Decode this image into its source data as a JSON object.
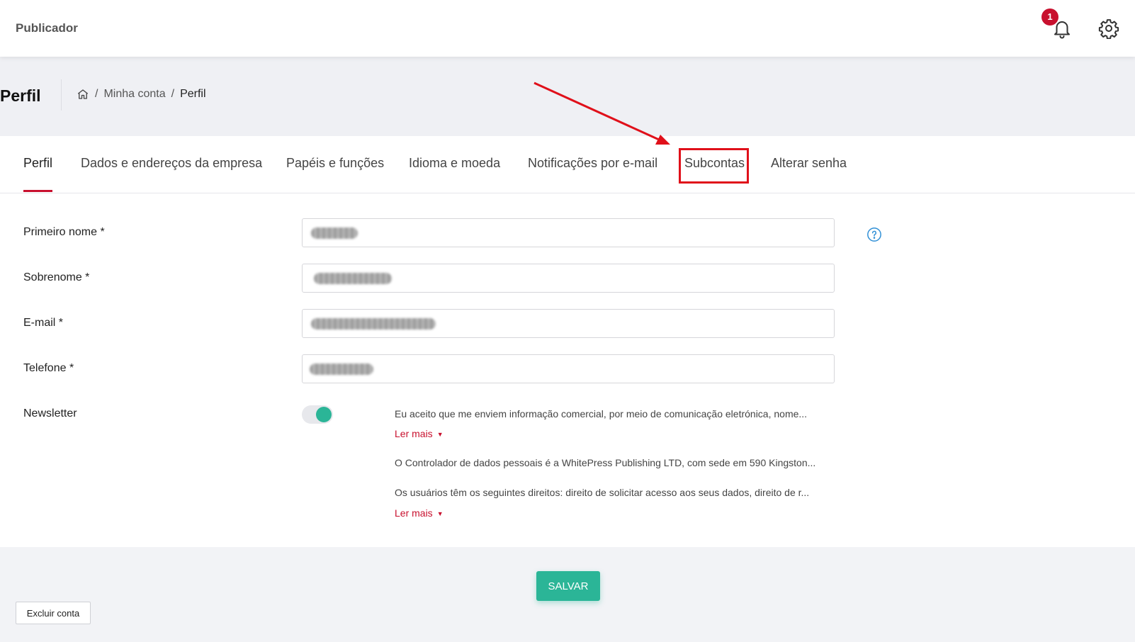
{
  "topbar": {
    "app_title": "Publicador",
    "notification_count": "1"
  },
  "header": {
    "page_title": "Perfil",
    "breadcrumb": {
      "separator": "/",
      "items": [
        "Minha conta",
        "Perfil"
      ]
    }
  },
  "tabs": [
    {
      "label": "Perfil",
      "active": true
    },
    {
      "label": "Dados e endereços da empresa",
      "active": false
    },
    {
      "label": "Papéis e funções",
      "active": false
    },
    {
      "label": "Idioma e moeda",
      "active": false
    },
    {
      "label": "Notificações por e-mail",
      "active": false
    },
    {
      "label": "Subcontas",
      "active": false
    },
    {
      "label": "Alterar senha",
      "active": false
    }
  ],
  "form": {
    "first_name_label": "Primeiro nome *",
    "last_name_label": "Sobrenome *",
    "email_label": "E-mail *",
    "phone_label": "Telefone *",
    "newsletter_label": "Newsletter",
    "newsletter_enabled": true
  },
  "legal": {
    "consent_text": "Eu aceito que me enviem informação comercial, por meio de comunicação eletrónica, nome...",
    "read_more_1": "Ler mais",
    "controller_text": "O Controlador de dados pessoais é a WhitePress Publishing LTD, com sede em 590 Kingston...",
    "rights_text": "Os usuários têm os seguintes direitos: direito de solicitar acesso aos seus dados, direito de r...",
    "read_more_2": "Ler mais"
  },
  "actions": {
    "save_label": "SALVAR",
    "delete_label": "Excluir conta"
  },
  "colors": {
    "accent": "#c8102e",
    "primary": "#2bb597",
    "help": "#2f8fd6",
    "annotation": "#e0101a"
  }
}
